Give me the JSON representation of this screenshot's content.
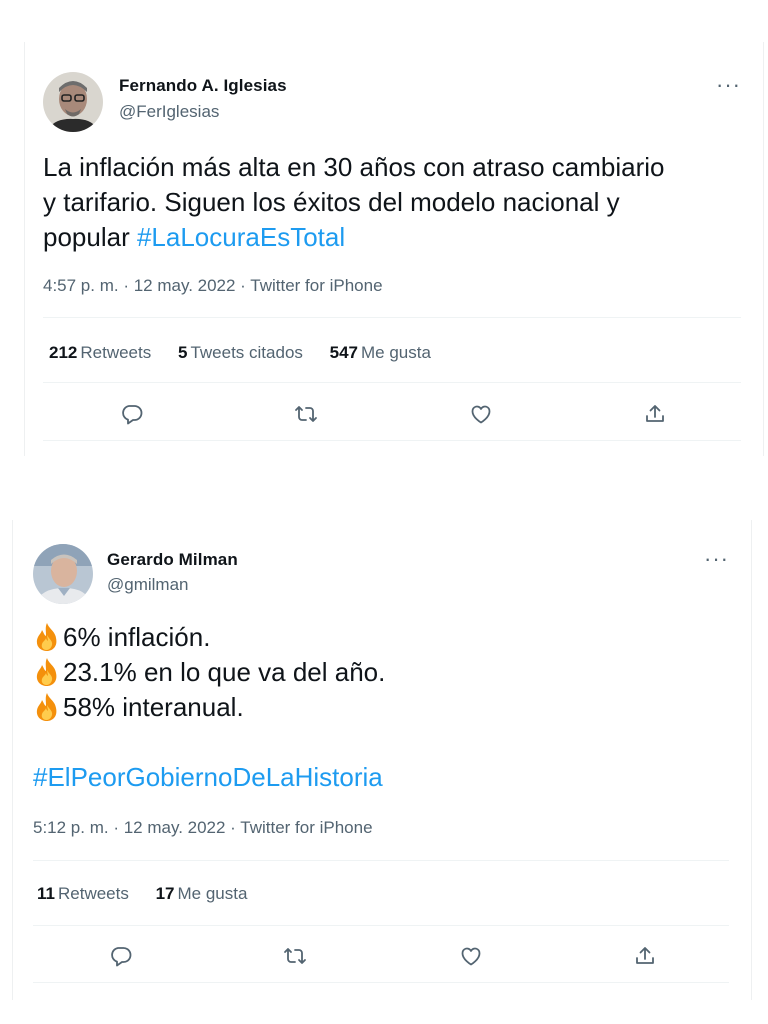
{
  "tweets": [
    {
      "author_name": "Fernando A. Iglesias",
      "handle": "@FerIglesias",
      "text_lines": [
        "La inflación más alta en 30 años con atraso cambiario",
        "y tarifario. Siguen los éxitos del modelo nacional y",
        "popular "
      ],
      "hashtag": "#LaLocuraEsTotal",
      "timestamp": "4:57 p. m. · 12 may. 2022 · Twitter for iPhone",
      "stats": [
        {
          "count": "212",
          "label": "Retweets"
        },
        {
          "count": "5",
          "label": "Tweets citados"
        },
        {
          "count": "547",
          "label": "Me gusta"
        }
      ]
    },
    {
      "author_name": "Gerardo Milman",
      "handle": "@gmilman",
      "text_lines": [
        "6% inflación.",
        "23.1% en lo que va del año.",
        "58% interanual."
      ],
      "hashtag": "#ElPeorGobiernoDeLaHistoria",
      "timestamp": "5:12 p. m. · 12 may. 2022 · Twitter for iPhone",
      "stats": [
        {
          "count": "11",
          "label": "Retweets"
        },
        {
          "count": "17",
          "label": "Me gusta"
        }
      ]
    }
  ],
  "more_label": "···",
  "icons": {
    "reply": "reply-icon",
    "retweet": "retweet-icon",
    "like": "like-icon",
    "share": "share-icon",
    "fire": "fire-emoji-icon"
  },
  "colors": {
    "hashtag": "#1d9bf0",
    "secondary_text": "#536471",
    "primary_text": "#0f1419"
  }
}
